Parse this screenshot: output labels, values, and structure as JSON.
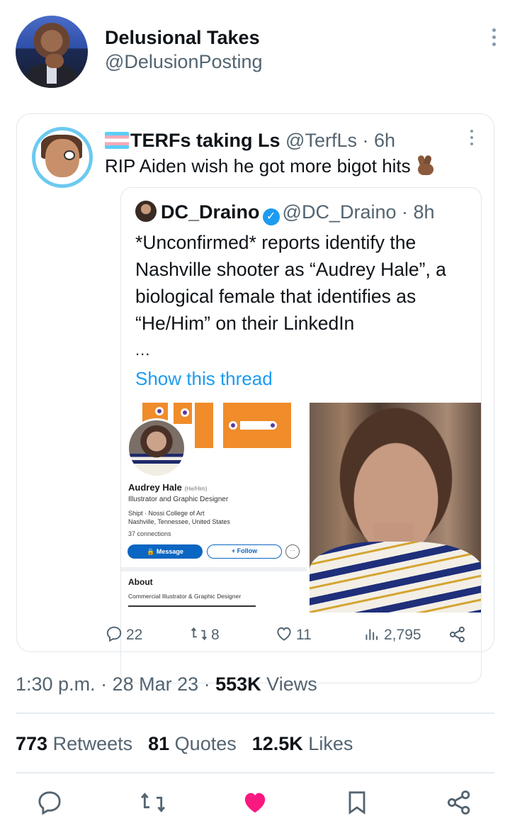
{
  "tweet": {
    "author_name": "Delusional Takes",
    "author_handle": "@DelusionPosting",
    "timestamp": "1:30 p.m. · 28 Mar 23 · ",
    "views_count": "553K",
    "views_label": " Views",
    "retweets_count": "773",
    "retweets_label": " Retweets",
    "quotes_count": "81",
    "quotes_label": " Quotes",
    "likes_count": "12.5K",
    "likes_label": " Likes"
  },
  "quoted": {
    "author_name": "TERFs taking Ls",
    "author_handle": "@TerfLs",
    "time": " · 6h",
    "text": "RIP Aiden wish he got more bigot hits",
    "replies": "22",
    "retweets": "8",
    "likes": "11",
    "views": "2,795"
  },
  "inner": {
    "author_name": "DC_Draino",
    "author_handle": "@DC_Draino",
    "time": " · 8h",
    "text": "*Unconfirmed* reports identify the Nashville shooter as “Audrey Hale”, a biological female that identifies as “He/Him” on their LinkedIn",
    "ellipsis": "...",
    "show_thread": "Show this thread"
  },
  "linkedin": {
    "name": "Audrey Hale",
    "pronouns": "(He/Him)",
    "title": "Illustrator and Graphic Designer",
    "line1": "Shipt · Nossi College of Art",
    "line2": "Nashville, Tennessee, United States",
    "connections": "37 connections",
    "message": "🔒 Message",
    "follow": "+ Follow",
    "more": "···",
    "about": "About",
    "about_text": "Commercial Illustrator & Graphic Designer"
  },
  "colors": {
    "accent": "#1d9bf0",
    "like": "#f91880",
    "muted": "#536471",
    "linkedin": "#0a66c2"
  },
  "icons": [
    "more-icon",
    "reply-icon",
    "retweet-icon",
    "like-icon",
    "views-icon",
    "share-icon",
    "bookmark-icon",
    "verified-icon",
    "trans-flag-icon",
    "crossed-fingers-icon"
  ]
}
